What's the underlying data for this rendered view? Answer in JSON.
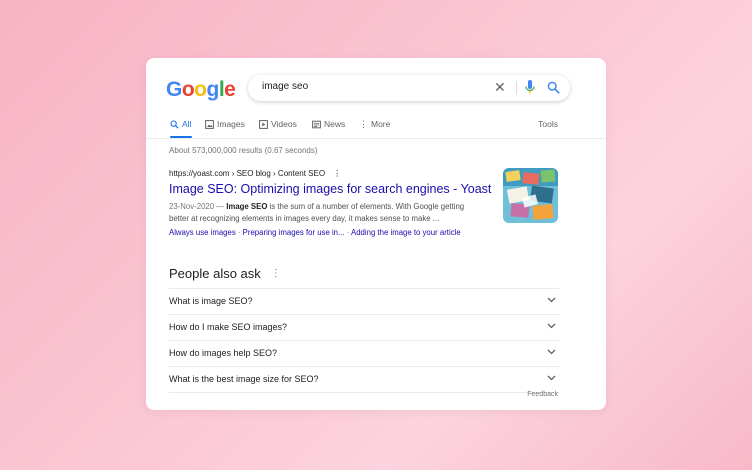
{
  "logo": {
    "letters": [
      "G",
      "o",
      "o",
      "g",
      "l",
      "e"
    ]
  },
  "search": {
    "query": "image seo",
    "clear_icon": "close-icon",
    "mic_icon": "microphone-icon",
    "search_icon": "search-icon"
  },
  "tabs": [
    {
      "label": "All",
      "icon": "search-icon",
      "active": true
    },
    {
      "label": "Images",
      "icon": "image-icon"
    },
    {
      "label": "Videos",
      "icon": "play-icon"
    },
    {
      "label": "News",
      "icon": "newspaper-icon"
    },
    {
      "label": "More",
      "icon": "more-vert-icon"
    }
  ],
  "tools_label": "Tools",
  "stats": "About 573,000,000 results (0.67 seconds)",
  "result": {
    "breadcrumb": "https://yoast.com › SEO blog › Content SEO",
    "title": "Image SEO: Optimizing images for search engines - Yoast",
    "date": "23-Nov-2020 —",
    "snippet_bold": "Image SEO",
    "snippet_rest": " is the sum of a number of elements. With Google getting better at recognizing elements in images every day, it makes sense to make ...",
    "sitelinks": [
      "Always use images",
      "Preparing images for use in...",
      "Adding the image to your article"
    ],
    "sitelink_separator": " · "
  },
  "people_also_ask": {
    "title": "People also ask",
    "questions": [
      "What is image SEO?",
      "How do I make SEO images?",
      "How do images help SEO?",
      "What is the best image size for SEO?"
    ]
  },
  "feedback_label": "Feedback",
  "colors": {
    "accent": "#1a73e8",
    "link": "#1a0dab",
    "background": "#f9bccb"
  }
}
